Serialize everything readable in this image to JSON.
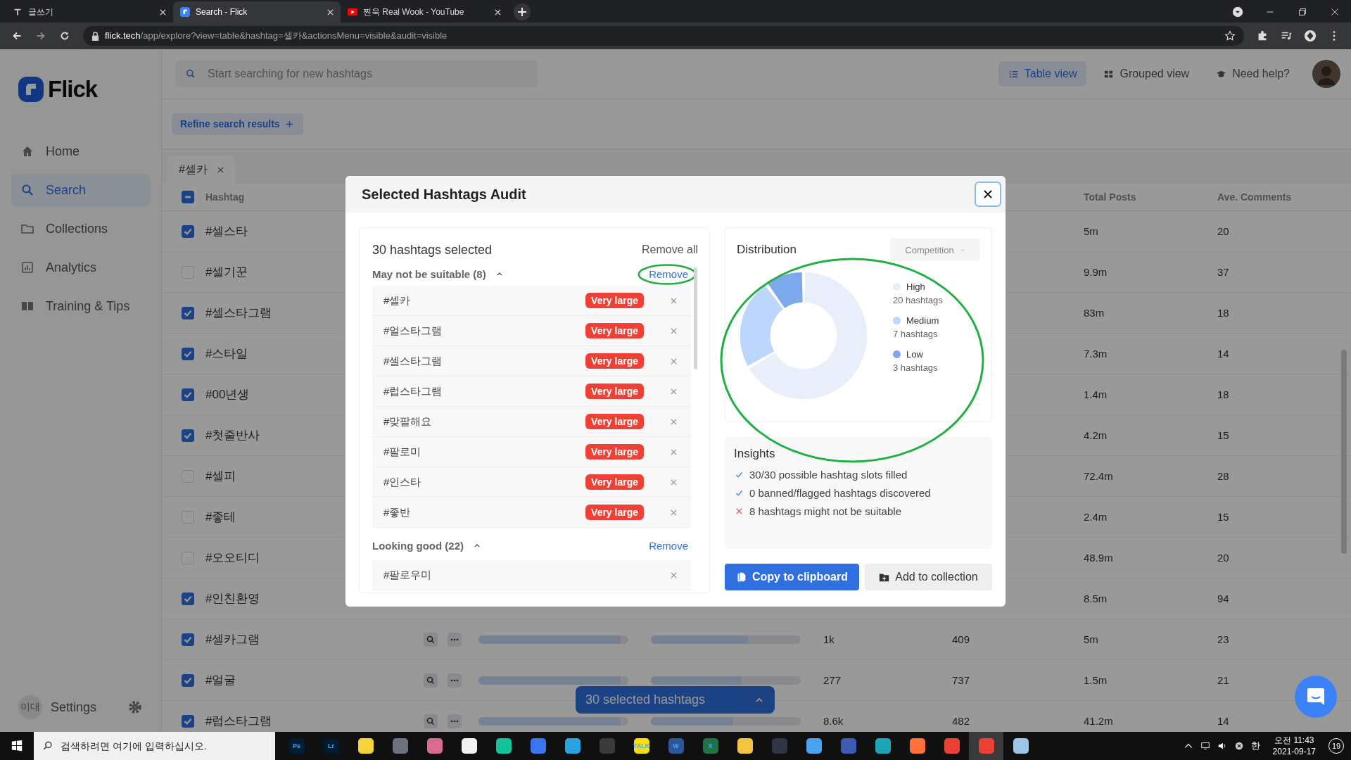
{
  "browser": {
    "tabs": [
      {
        "title": "글쓰기",
        "selected": false
      },
      {
        "title": "Search - Flick",
        "selected": true
      },
      {
        "title": "찐욱 Real Wook - YouTube",
        "selected": false
      }
    ],
    "address": {
      "domain": "flick.tech",
      "path": "/app/explore?view=table&hashtag=셀카&actionsMenu=visible&audit=visible"
    }
  },
  "sidebar": {
    "logo": "Flick",
    "items": [
      {
        "label": "Home",
        "selected": false
      },
      {
        "label": "Search",
        "selected": true
      },
      {
        "label": "Collections",
        "selected": false
      },
      {
        "label": "Analytics",
        "selected": false
      },
      {
        "label": "Training & Tips",
        "selected": false
      }
    ],
    "user": {
      "initials": "이대",
      "label": "Settings"
    }
  },
  "header": {
    "search": {
      "placeholder": "Start searching for new hashtags"
    },
    "views": [
      {
        "label": "Table view",
        "selected": true
      },
      {
        "label": "Grouped view",
        "selected": false
      }
    ],
    "help": "Need help?"
  },
  "refine": {
    "label": "Refine search results"
  },
  "query_tabs": [
    {
      "label": "#셀카"
    }
  ],
  "table": {
    "select_all_partial": true,
    "columns": [
      "Hashtag",
      "Total Posts",
      "Ave. Comments"
    ],
    "rows": [
      {
        "hashtag": "#셀스타",
        "checked": true,
        "total_posts": "5m",
        "ave_comments": "20"
      },
      {
        "hashtag": "#셀기꾼",
        "checked": false,
        "total_posts": "9.9m",
        "ave_comments": "37"
      },
      {
        "hashtag": "#셀스타그램",
        "checked": true,
        "total_posts": "83m",
        "ave_comments": "18"
      },
      {
        "hashtag": "#스타일",
        "checked": true,
        "total_posts": "7.3m",
        "ave_comments": "14"
      },
      {
        "hashtag": "#00년생",
        "checked": true,
        "total_posts": "1.4m",
        "ave_comments": "18"
      },
      {
        "hashtag": "#첫줄반사",
        "checked": true,
        "total_posts": "4.2m",
        "ave_comments": "15"
      },
      {
        "hashtag": "#셀피",
        "checked": false,
        "total_posts": "72.4m",
        "ave_comments": "28"
      },
      {
        "hashtag": "#좋테",
        "checked": false,
        "total_posts": "2.4m",
        "ave_comments": "15"
      },
      {
        "hashtag": "#오오티디",
        "checked": false,
        "total_posts": "48.9m",
        "ave_comments": "20"
      },
      {
        "hashtag": "#인친환영",
        "checked": true,
        "total_posts": "8.5m",
        "ave_comments": "94"
      },
      {
        "hashtag": "#셀카그램",
        "checked": true,
        "bars": [
          {
            "level": 0.95
          },
          {
            "level": 0.65
          }
        ],
        "column_3": "1k",
        "column_4": "409",
        "total_posts": "5m",
        "ave_comments": "23"
      },
      {
        "hashtag": "#얼굴",
        "checked": true,
        "bars": [
          {
            "level": 0.95
          },
          {
            "level": 0.6
          }
        ],
        "column_3": "277",
        "column_4": "737",
        "total_posts": "1.5m",
        "ave_comments": "21"
      },
      {
        "hashtag": "#럽스타그램",
        "checked": true,
        "bars": [
          {
            "level": 0.95
          },
          {
            "level": 0.55
          }
        ],
        "column_3": "8.6k",
        "column_4": "482",
        "total_posts": "41.2m",
        "ave_comments": "14"
      }
    ]
  },
  "selection_bar": {
    "label": "30 selected hashtags"
  },
  "modal": {
    "title": "Selected Hashtags Audit",
    "selected": {
      "title": "30 hashtags selected",
      "remove_all": "Remove all",
      "groups": [
        {
          "label": "May not be suitable (8)",
          "remove": "Remove",
          "remove_circled": true,
          "items": [
            {
              "tag": "#셀카",
              "badge": "Very large"
            },
            {
              "tag": "#얼스타그램",
              "badge": "Very large"
            },
            {
              "tag": "#셀스타그램",
              "badge": "Very large"
            },
            {
              "tag": "#럽스타그램",
              "badge": "Very large"
            },
            {
              "tag": "#맞팔해요",
              "badge": "Very large"
            },
            {
              "tag": "#팔로미",
              "badge": "Very large"
            },
            {
              "tag": "#인스타",
              "badge": "Very large"
            },
            {
              "tag": "#좋반",
              "badge": "Very large"
            }
          ]
        },
        {
          "label": "Looking good (22)",
          "remove": "Remove",
          "remove_circled": false,
          "items": [
            {
              "tag": "#팔로우미"
            }
          ]
        }
      ]
    },
    "distribution": {
      "title": "Distribution",
      "dropdown": "Competition",
      "circled": true,
      "chart_data": {
        "type": "donut",
        "categories": [
          "High",
          "Medium",
          "Low"
        ],
        "values": [
          66.7,
          23.3,
          10
        ]
      },
      "legend": [
        {
          "count": "20 hashtags",
          "color": "#e8effb"
        },
        {
          "count": "7 hashtags",
          "color": "#bcd6fc"
        },
        {
          "count": "3 hashtags",
          "color": "#7ea8ec"
        }
      ]
    },
    "insights": {
      "title": "Insights",
      "items": [
        {
          "kind": "pass",
          "text": "30/30 possible hashtag slots filled"
        },
        {
          "kind": "pass",
          "text": "0 banned/flagged hashtags discovered"
        },
        {
          "kind": "fail",
          "text": "8 hashtags might not be suitable"
        }
      ]
    },
    "buttons": [
      {
        "kind": "primary",
        "label": "Copy to clipboard"
      },
      {
        "kind": "secondary",
        "label": "Add to collection"
      }
    ]
  },
  "taskbar": {
    "search": {
      "placeholder": "검색하려면 여기에 입력하십시오."
    },
    "apps": [
      {
        "label": "Ps",
        "color": "#001e36",
        "selected": false
      },
      {
        "label": "Lr",
        "color": "#001a2f",
        "selected": false
      },
      {
        "color": "#f7d33a",
        "selected": false
      },
      {
        "color": "#6b7280",
        "selected": false
      },
      {
        "color": "#d96b8f",
        "selected": false
      },
      {
        "color": "#f2f2f2",
        "selected": false
      },
      {
        "color": "#15c39a",
        "selected": false
      },
      {
        "color": "#3a76f0",
        "selected": false
      },
      {
        "color": "#2aa3e0",
        "selected": false
      },
      {
        "color": "#3a3a3a",
        "selected": false
      },
      {
        "label": "TALK",
        "color": "#f9e000",
        "selected": false
      },
      {
        "label": "W",
        "color": "#2b579a",
        "selected": false
      },
      {
        "label": "X",
        "color": "#217346",
        "selected": false
      },
      {
        "color": "#f3c343",
        "selected": false
      },
      {
        "color": "#2f3542",
        "selected": false
      },
      {
        "color": "#4aa3f0",
        "selected": false
      },
      {
        "color": "#3b5bb5",
        "selected": false
      },
      {
        "color": "#1ba6b8",
        "selected": false
      },
      {
        "color": "#ff7139",
        "selected": false
      },
      {
        "color": "#e94235",
        "selected": false
      },
      {
        "color": "#e94235",
        "selected": true
      },
      {
        "color": "#9ec5e8",
        "selected": false
      }
    ],
    "ime": "한",
    "time": "오전 11:43",
    "date": "2021-09-17",
    "notifications": "19"
  }
}
